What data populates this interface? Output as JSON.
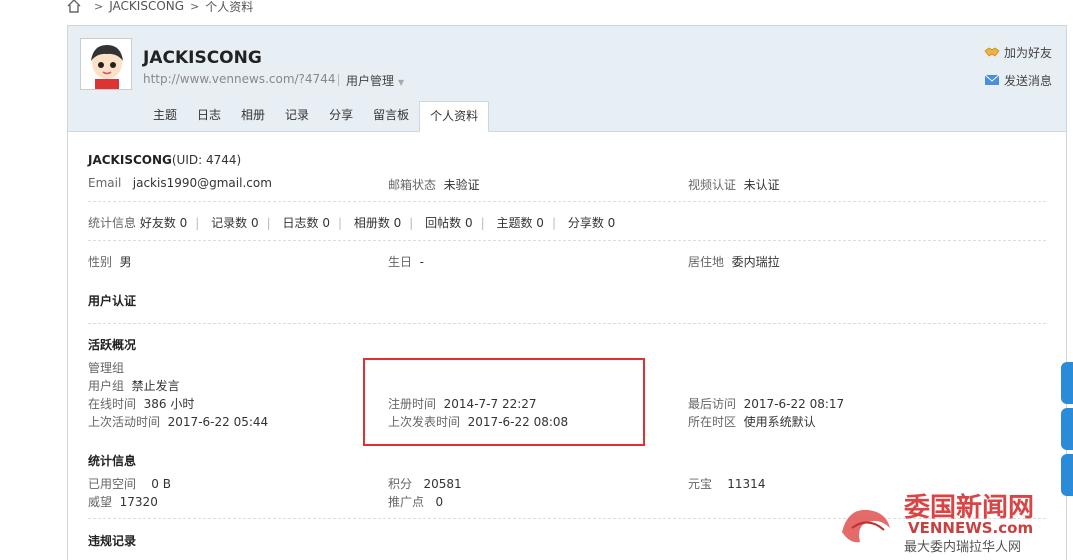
{
  "breadcrumb": {
    "items": [
      "JACKISCONG",
      "个人资料"
    ]
  },
  "profile": {
    "name": "JACKISCONG",
    "url": "http://www.vennews.com/?4744",
    "manage_label": "用户管理",
    "add_friend": "加为好友",
    "send_message": "发送消息"
  },
  "tabs": [
    "主题",
    "日志",
    "相册",
    "记录",
    "分享",
    "留言板",
    "个人资料"
  ],
  "info": {
    "name": "JACKISCONG",
    "uid": "(UID: 4744)",
    "email_label": "Email",
    "email": "jackis1990@gmail.com",
    "mail_status_label": "邮箱状态",
    "mail_status": "未验证",
    "video_label": "视频认证",
    "video_status": "未认证",
    "stats_label": "统计信息",
    "stats": [
      "好友数 0",
      "记录数 0",
      "日志数 0",
      "相册数 0",
      "回帖数 0",
      "主题数 0",
      "分享数 0"
    ],
    "gender_label": "性别",
    "gender": "男",
    "birthday_label": "生日",
    "birthday": "-",
    "residence_label": "居住地",
    "residence": "委内瑞拉",
    "user_auth_title": "用户认证"
  },
  "activity": {
    "title": "活跃概况",
    "admin_group_label": "管理组",
    "user_group_label": "用户组",
    "user_group": "禁止发言",
    "online_label": "在线时间",
    "online": "386 小时",
    "reg_label": "注册时间",
    "reg": "2014-7-7 22:27",
    "last_visit_label": "最后访问",
    "last_visit": "2017-6-22 08:17",
    "last_active_label": "上次活动时间",
    "last_active": "2017-6-22 05:44",
    "last_post_label": "上次发表时间",
    "last_post": "2017-6-22 08:08",
    "timezone_label": "所在时区",
    "timezone": "使用系统默认"
  },
  "stats_section": {
    "title": "统计信息",
    "space_label": "已用空间",
    "space": "0 B",
    "points_label": "积分",
    "points": "20581",
    "yuanbao_label": "元宝",
    "yuanbao": "11314",
    "prestige_label": "威望",
    "prestige": "17320",
    "promo_label": "推广点",
    "promo": "0"
  },
  "violation_title": "违规记录",
  "watermark": {
    "logo": "委国新闻网",
    "domain": "VENNEWS.com",
    "slogan": "最大委内瑞拉华人网"
  },
  "colors": {
    "accent_red": "#e03030",
    "header_bg": "#e8eff4",
    "side_blue": "#2a8bd8"
  }
}
